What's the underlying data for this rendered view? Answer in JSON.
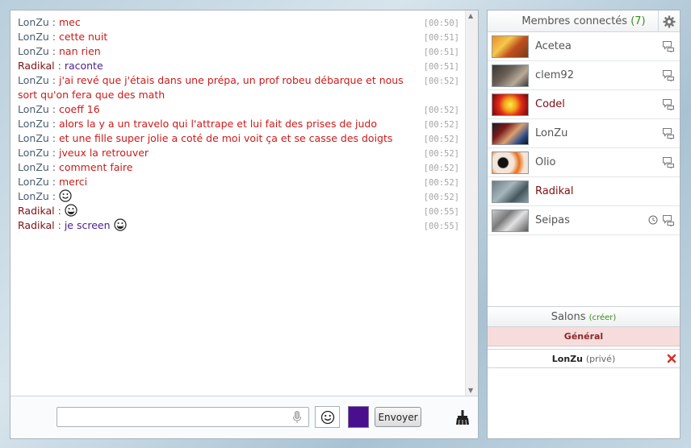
{
  "colors": {
    "user_sender": "#4a5d6e",
    "admin_sender": "#7d0f12",
    "red_text": "#cc1a1a",
    "purple_text": "#4a1d8c",
    "online_count": "#3a8a1e",
    "selected_color": "#4a0f8f"
  },
  "messages": [
    {
      "sender": "LonZu",
      "sep": " : ",
      "text": "mec",
      "time": "[00:50]",
      "role": "user",
      "color": "red"
    },
    {
      "sender": "LonZu",
      "sep": " : ",
      "text": "cette nuit",
      "time": "[00:51]",
      "role": "user",
      "color": "red"
    },
    {
      "sender": "LonZu",
      "sep": " : ",
      "text": "nan rien",
      "time": "[00:51]",
      "role": "user",
      "color": "red"
    },
    {
      "sender": "Radikal",
      "sep": " : ",
      "text": "raconte",
      "time": "[00:51]",
      "role": "admin",
      "color": "purple"
    },
    {
      "sender": "LonZu",
      "sep": " : ",
      "text": "j'ai revé que j'étais dans une prépa, un prof robeu débarque et nous sort qu'on fera que des math",
      "time": "[00:52]",
      "role": "user",
      "color": "red"
    },
    {
      "sender": "LonZu",
      "sep": " : ",
      "text": "coeff 16",
      "time": "[00:52]",
      "role": "user",
      "color": "red"
    },
    {
      "sender": "LonZu",
      "sep": " : ",
      "text": "alors la y a un travelo qui l'attrape et lui fait des prises de judo",
      "time": "[00:52]",
      "role": "user",
      "color": "red"
    },
    {
      "sender": "LonZu",
      "sep": " : ",
      "text": "et une fille super jolie a coté de moi voit ça et se casse des doigts",
      "time": "[00:52]",
      "role": "user",
      "color": "red"
    },
    {
      "sender": "LonZu",
      "sep": " : ",
      "text": "jveux la retrouver",
      "time": "[00:52]",
      "role": "user",
      "color": "red"
    },
    {
      "sender": "LonZu",
      "sep": " : ",
      "text": "comment faire",
      "time": "[00:52]",
      "role": "user",
      "color": "red"
    },
    {
      "sender": "LonZu",
      "sep": " : ",
      "text": "merci",
      "time": "[00:52]",
      "role": "user",
      "color": "red"
    },
    {
      "sender": "LonZu",
      "sep": " : ",
      "text": "",
      "time": "[00:52]",
      "role": "user",
      "color": "red",
      "smiley": "smile"
    },
    {
      "sender": "Radikal",
      "sep": " : ",
      "text": "",
      "time": "[00:55]",
      "role": "admin",
      "color": "purple",
      "smiley": "grin"
    },
    {
      "sender": "Radikal",
      "sep": " : ",
      "text": "je screen",
      "time": "[00:55]",
      "role": "admin",
      "color": "purple",
      "smiley": "grin"
    }
  ],
  "composer": {
    "input_value": "",
    "send_label": "Envoyer"
  },
  "members": {
    "title": "Membres connectés",
    "count": "(7)",
    "list": [
      {
        "name": "Acetea",
        "role": "user",
        "avatar": "a1",
        "chat": true,
        "away": false
      },
      {
        "name": "clem92",
        "role": "user",
        "avatar": "a2",
        "chat": true,
        "away": false
      },
      {
        "name": "Codel",
        "role": "admin",
        "avatar": "a3",
        "chat": true,
        "away": false
      },
      {
        "name": "LonZu",
        "role": "user",
        "avatar": "a4",
        "chat": true,
        "away": false
      },
      {
        "name": "Olio",
        "role": "user",
        "avatar": "a5",
        "chat": true,
        "away": false
      },
      {
        "name": "Radikal",
        "role": "admin",
        "avatar": "a6",
        "chat": false,
        "away": false
      },
      {
        "name": "Seipas",
        "role": "user",
        "avatar": "a7",
        "chat": true,
        "away": true
      }
    ]
  },
  "rooms": {
    "title": "Salons",
    "create": "(créer)",
    "general": "Général",
    "private_name": "LonZu",
    "private_tag": "(privé)"
  },
  "icons": {
    "settings": "gear-icon",
    "chat": "speech-bubble-icon",
    "away": "clock-icon",
    "close": "close-icon",
    "mic": "microphone-icon",
    "smiley": "smiley-icon",
    "clear": "broom-icon"
  }
}
